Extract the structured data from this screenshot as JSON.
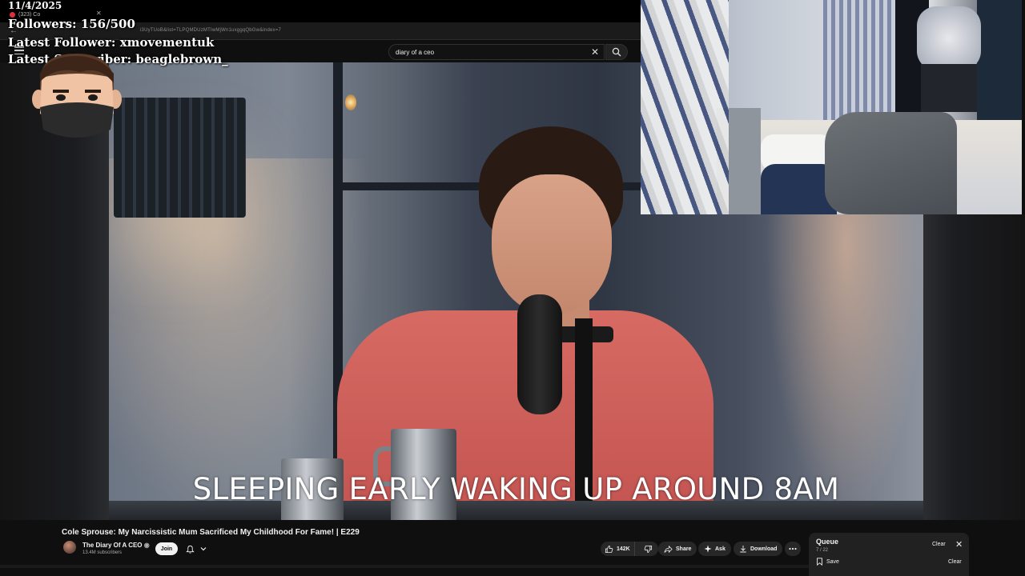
{
  "overlay": {
    "date": "11/4/2025",
    "followers": "Followers: 156/500",
    "latest_follower": "Latest Follower: xmovementuk",
    "latest_subscriber": "Latest Subscriber: beaglebrown_"
  },
  "browser": {
    "tab_label": "(323) Co",
    "url": "i3UyTUoB&list=TLPQMDUzMTIwMjWn1uxggqQbGw&index=7"
  },
  "search": {
    "query": "diary of a ceo"
  },
  "video": {
    "caption": "SLEEPING EARLY WAKING UP AROUND 8AM",
    "title": "Cole Sprouse: My Narcissistic Mum Sacrificed My Childhood For Fame! | E229"
  },
  "channel": {
    "name": "The Diary Of A CEO",
    "subscribers": "13.4M subscribers",
    "join_label": "Join"
  },
  "actions": {
    "likes": "142K",
    "share_label": "Share",
    "ask_label": "Ask",
    "download_label": "Download"
  },
  "queue": {
    "title": "Queue",
    "count": "7 / 22",
    "clear_label": "Clear",
    "save_label": "Save",
    "clear_label_2": "Clear"
  },
  "icons": {
    "search": "search-icon",
    "clear": "close-icon",
    "menu": "menu-icon",
    "bell": "bell-icon",
    "like": "thumbs-up-icon",
    "dislike": "thumbs-down-icon",
    "share": "share-icon",
    "ask": "sparkle-icon",
    "download": "download-icon",
    "more": "more-icon",
    "save": "bookmark-icon"
  },
  "colors": {
    "background": "#0f0f0f",
    "pill": "#272727",
    "join": "#f1f1f1"
  }
}
